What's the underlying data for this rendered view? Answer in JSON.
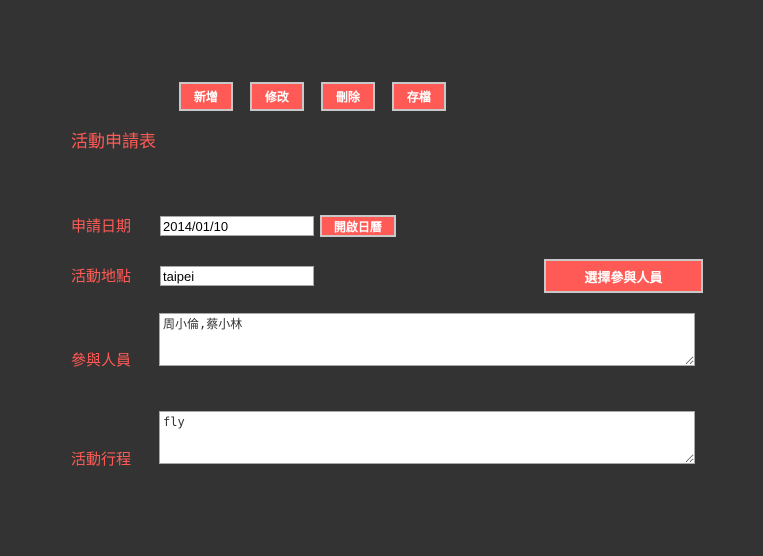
{
  "toolbar": {
    "new_label": "新增",
    "edit_label": "修改",
    "delete_label": "刪除",
    "save_label": "存檔"
  },
  "form": {
    "title": "活動申請表",
    "date": {
      "label": "申請日期",
      "value": "2014/01/10",
      "calendar_button": "開啟日曆"
    },
    "location": {
      "label": "活動地點",
      "value": "taipei",
      "select_button": "選擇參與人員"
    },
    "participants": {
      "label": "參與人員",
      "value": "周小倫,蔡小林"
    },
    "schedule": {
      "label": "活動行程",
      "value": "fly"
    }
  },
  "colors": {
    "background": "#333333",
    "accent": "#ff5a55",
    "button_border": "#c8c8c8"
  }
}
